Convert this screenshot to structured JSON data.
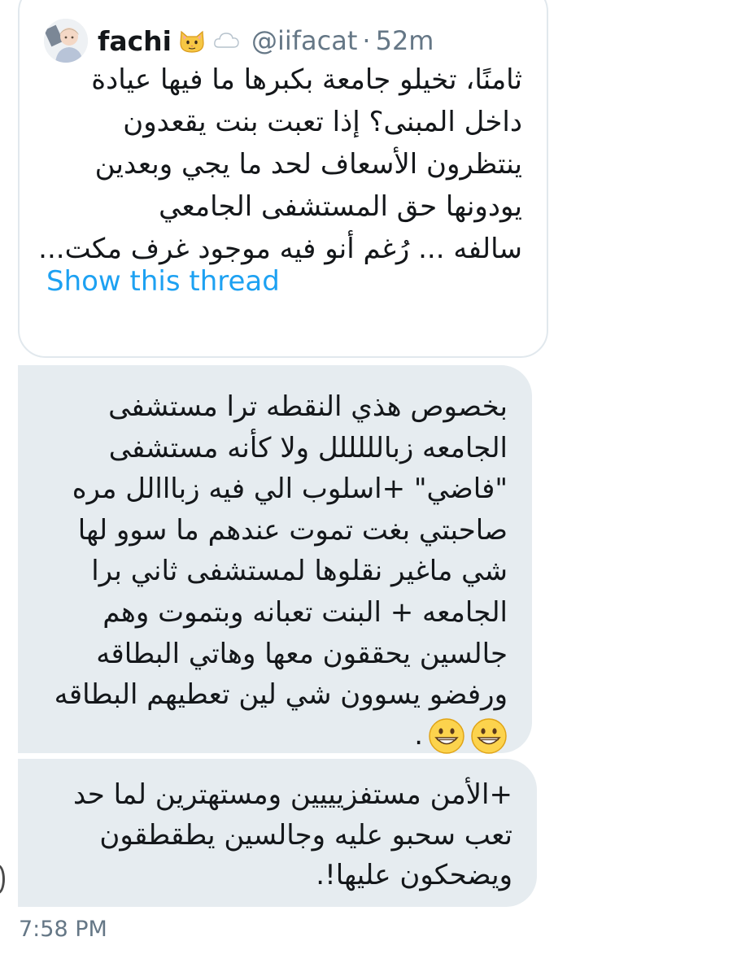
{
  "quoted_tweet": {
    "display_name": "fachi",
    "name_emojis": [
      "cat-face-emoji",
      "cloud-emoji"
    ],
    "handle": "@iifacat",
    "separator": "·",
    "time_ago": "52m",
    "text_lines": [
      "ثامنًا، تخيلو جامعة بكبرها ما فيها عيادة",
      "داخل المبنى؟ إذا تعبت بنت يقعدون",
      "ينتظرون الأسعاف لحد ما يجي وبعدين",
      "يودونها حق المستشفى الجامعي",
      "سالفه ... رُغم أنو فيه موجود غرف مكت..."
    ],
    "show_thread_label": "Show this thread"
  },
  "messages": [
    {
      "lines": [
        "بخصوص هذي النقطه ترا مستشفى",
        "الجامعه زبالللللل ولا كأنه مستشفى",
        "\"فاضي\" +اسلوب الي فيه زبااالل مره",
        "صاحبتي بغت تموت عندهم ما سوو لها",
        "شي ماغير نقلوها لمستشفى ثاني برا",
        "الجامعه + البنت تعبانه وبتموت وهم",
        "جالسين يحققون معها وهاتي البطاقه",
        "ورفضو يسوون شي لين تعطيهم البطاقه"
      ],
      "last_line_text": ".",
      "last_line_emojis": [
        "grinning-face-emoji",
        "grinning-face-emoji"
      ]
    },
    {
      "lines": [
        "+الأمن مستفزيييين ومستهترين لما حد",
        "تعب سحبو عليه وجالسين يطقطقون",
        "ويضحكون عليها!."
      ]
    }
  ],
  "timestamp": "7:58 PM",
  "colors": {
    "link_blue": "#1da1f2",
    "muted_gray": "#657786",
    "bubble_gray": "#e6ecf0",
    "card_border": "#e1e8ed"
  }
}
